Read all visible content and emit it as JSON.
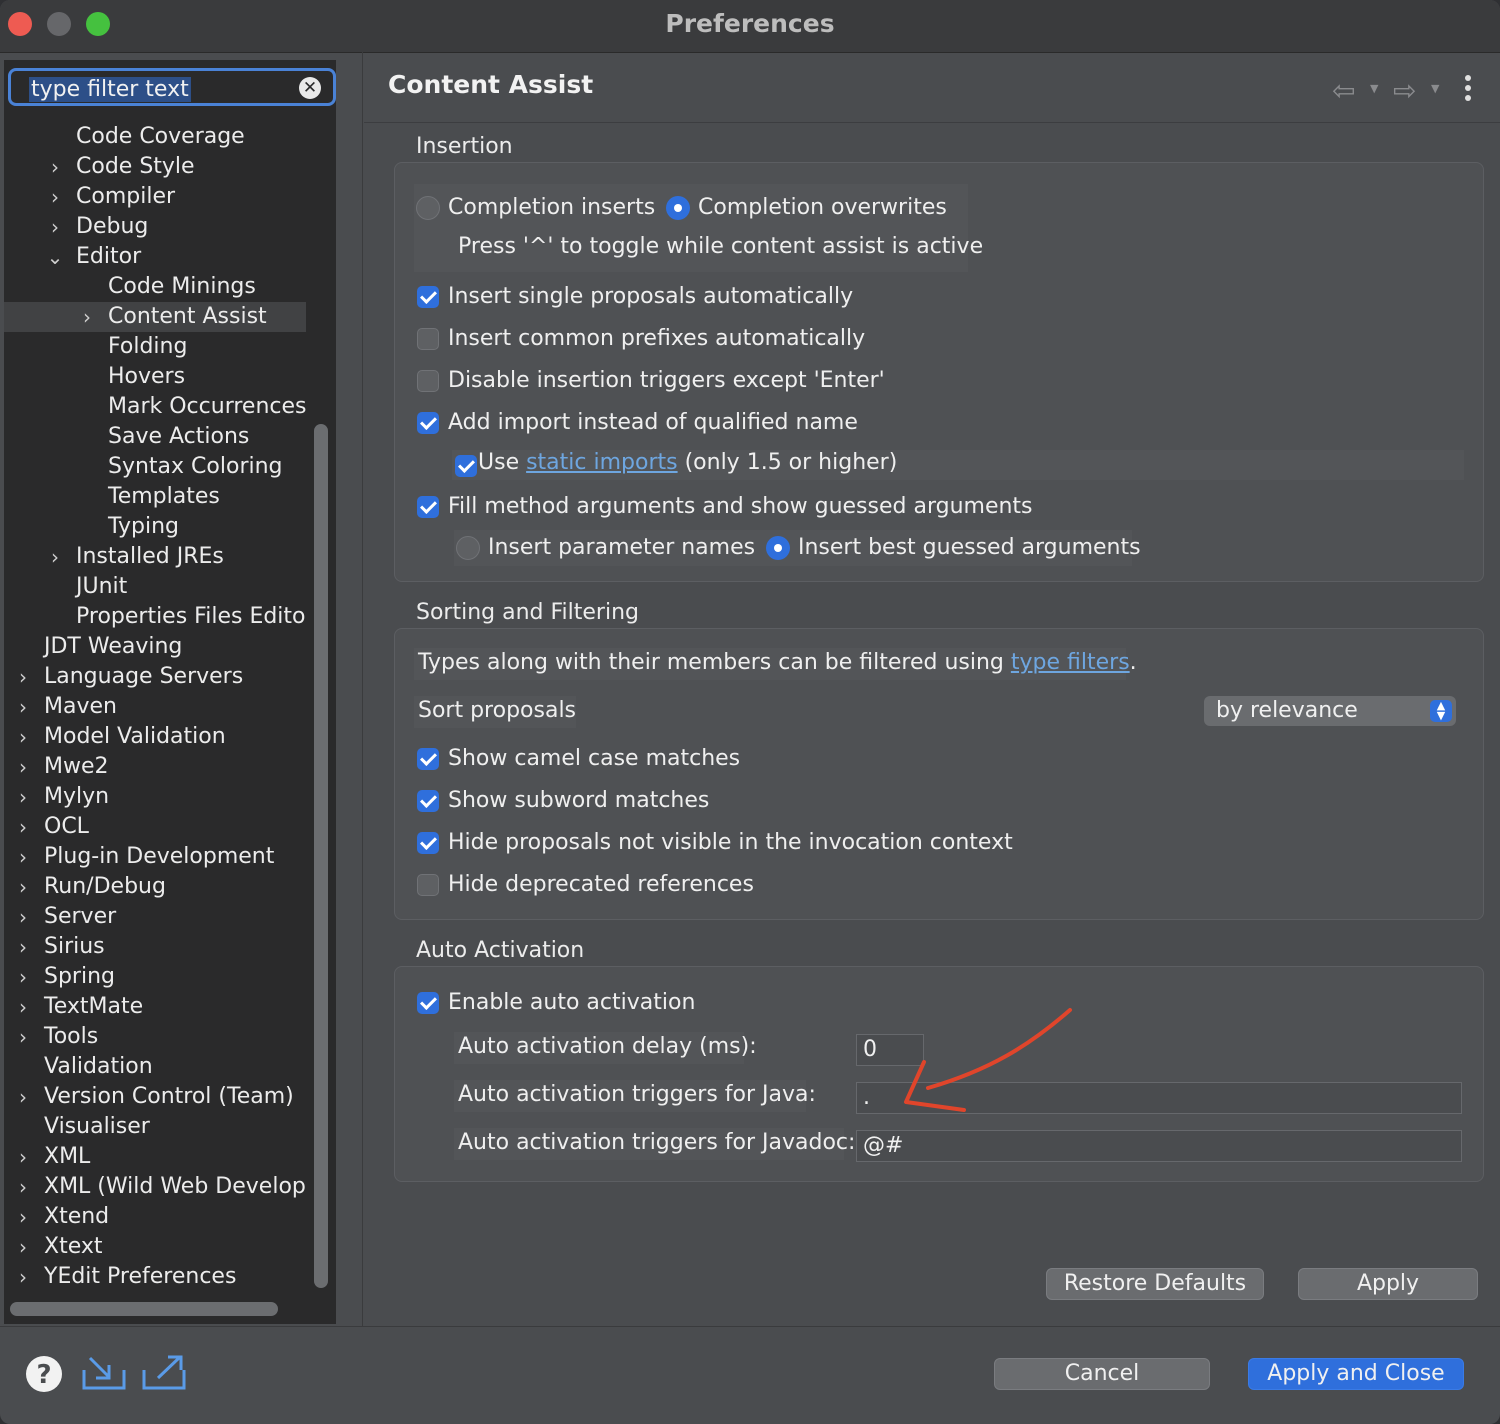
{
  "window": {
    "title": "Preferences"
  },
  "filter": {
    "placeholder": "type filter text"
  },
  "tree": [
    {
      "label": "Code Coverage",
      "indent": 2,
      "chevron": ""
    },
    {
      "label": "Code Style",
      "indent": 2,
      "chevron": "right"
    },
    {
      "label": "Compiler",
      "indent": 2,
      "chevron": "right"
    },
    {
      "label": "Debug",
      "indent": 2,
      "chevron": "right"
    },
    {
      "label": "Editor",
      "indent": 2,
      "chevron": "down"
    },
    {
      "label": "Code Minings",
      "indent": 3,
      "chevron": ""
    },
    {
      "label": "Content Assist",
      "indent": 3,
      "chevron": "right",
      "selected": true
    },
    {
      "label": "Folding",
      "indent": 3,
      "chevron": ""
    },
    {
      "label": "Hovers",
      "indent": 3,
      "chevron": ""
    },
    {
      "label": "Mark Occurrences",
      "indent": 3,
      "chevron": ""
    },
    {
      "label": "Save Actions",
      "indent": 3,
      "chevron": ""
    },
    {
      "label": "Syntax Coloring",
      "indent": 3,
      "chevron": ""
    },
    {
      "label": "Templates",
      "indent": 3,
      "chevron": ""
    },
    {
      "label": "Typing",
      "indent": 3,
      "chevron": ""
    },
    {
      "label": "Installed JREs",
      "indent": 2,
      "chevron": "right"
    },
    {
      "label": "JUnit",
      "indent": 2,
      "chevron": ""
    },
    {
      "label": "Properties Files Editor",
      "indent": 2,
      "chevron": ""
    },
    {
      "label": "JDT Weaving",
      "indent": 1,
      "chevron": ""
    },
    {
      "label": "Language Servers",
      "indent": 1,
      "chevron": "right"
    },
    {
      "label": "Maven",
      "indent": 1,
      "chevron": "right"
    },
    {
      "label": "Model Validation",
      "indent": 1,
      "chevron": "right"
    },
    {
      "label": "Mwe2",
      "indent": 1,
      "chevron": "right"
    },
    {
      "label": "Mylyn",
      "indent": 1,
      "chevron": "right"
    },
    {
      "label": "OCL",
      "indent": 1,
      "chevron": "right"
    },
    {
      "label": "Plug-in Development",
      "indent": 1,
      "chevron": "right"
    },
    {
      "label": "Run/Debug",
      "indent": 1,
      "chevron": "right"
    },
    {
      "label": "Server",
      "indent": 1,
      "chevron": "right"
    },
    {
      "label": "Sirius",
      "indent": 1,
      "chevron": "right"
    },
    {
      "label": "Spring",
      "indent": 1,
      "chevron": "right"
    },
    {
      "label": "TextMate",
      "indent": 1,
      "chevron": "right"
    },
    {
      "label": "Tools",
      "indent": 1,
      "chevron": "right"
    },
    {
      "label": "Validation",
      "indent": 1,
      "chevron": ""
    },
    {
      "label": "Version Control (Team)",
      "indent": 1,
      "chevron": "right"
    },
    {
      "label": "Visualiser",
      "indent": 1,
      "chevron": ""
    },
    {
      "label": "XML",
      "indent": 1,
      "chevron": "right"
    },
    {
      "label": "XML (Wild Web Develope",
      "indent": 1,
      "chevron": "right"
    },
    {
      "label": "Xtend",
      "indent": 1,
      "chevron": "right"
    },
    {
      "label": "Xtext",
      "indent": 1,
      "chevron": "right"
    },
    {
      "label": "YEdit Preferences",
      "indent": 1,
      "chevron": "right"
    }
  ],
  "page": {
    "title": "Content Assist"
  },
  "insertion": {
    "title": "Insertion",
    "completion_inserts": "Completion inserts",
    "completion_overwrites": "Completion overwrites",
    "toggle_hint": "Press '^' to toggle while content assist is active",
    "single_proposals": "Insert single proposals automatically",
    "common_prefixes": "Insert common prefixes automatically",
    "disable_triggers": "Disable insertion triggers except 'Enter'",
    "add_import": "Add import instead of qualified name",
    "use_prefix": "Use ",
    "static_imports": "static imports",
    "use_suffix": " (only 1.5 or higher)",
    "fill_method": "Fill method arguments and show guessed arguments",
    "param_names": "Insert parameter names",
    "best_guessed": "Insert best guessed arguments"
  },
  "sorting": {
    "title": "Sorting and Filtering",
    "types_prefix": "Types along with their members can be filtered using ",
    "type_filters": "type filters",
    "types_suffix": ".",
    "sort_proposals": "Sort proposals",
    "sort_value": "by relevance",
    "camel_case": "Show camel case matches",
    "subword": "Show subword matches",
    "hide_not_visible": "Hide proposals not visible in the invocation context",
    "hide_deprecated": "Hide deprecated references"
  },
  "auto": {
    "title": "Auto Activation",
    "enable": "Enable auto activation",
    "delay_label": "Auto activation delay (ms):",
    "delay_value": "0",
    "java_label": "Auto activation triggers for Java:",
    "java_value": ".",
    "javadoc_label": "Auto activation triggers for Javadoc:",
    "javadoc_value": "@#"
  },
  "buttons": {
    "restore": "Restore Defaults",
    "apply": "Apply",
    "cancel": "Cancel",
    "apply_close": "Apply and Close"
  },
  "colors": {
    "accent": "#2f6fdc",
    "annotation": "#e0452b",
    "link": "#6ea6e0"
  }
}
